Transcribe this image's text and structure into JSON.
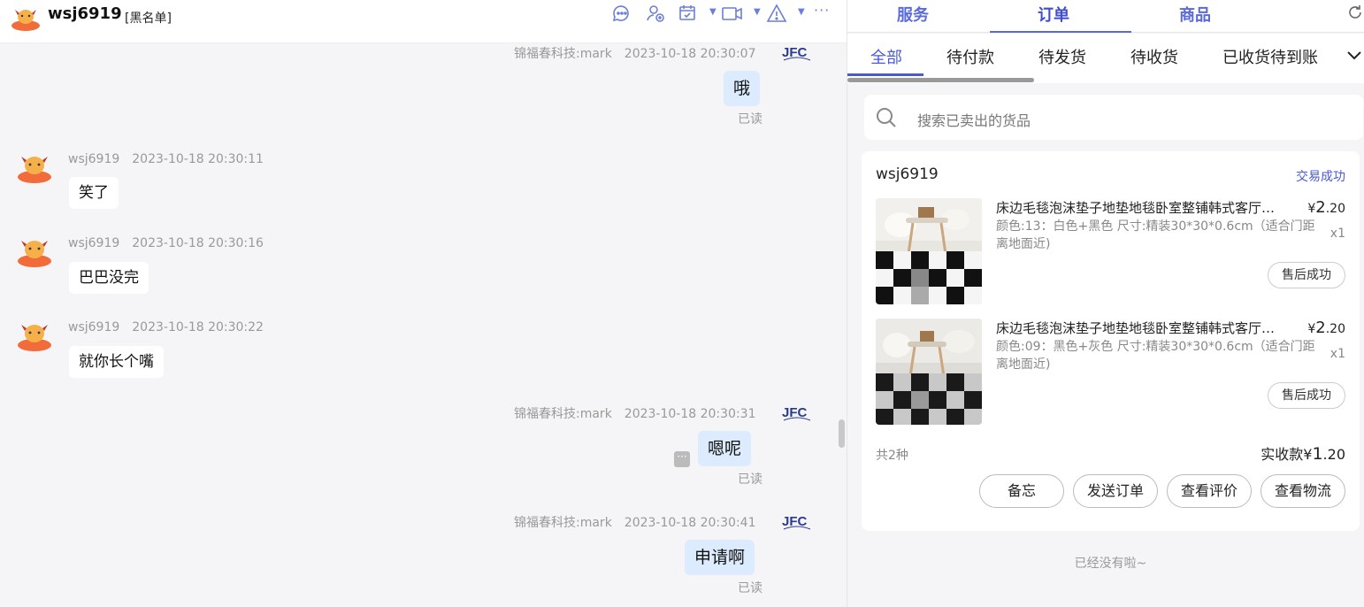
{
  "header": {
    "contact_name": "wsj6919",
    "contact_tag": "[黑名单]"
  },
  "messages": [
    {
      "sender": "锦福春科技:mark",
      "time": "2023-10-18 20:30:07",
      "text": "哦",
      "status": "已读",
      "mine": true
    },
    {
      "sender": "wsj6919",
      "time": "2023-10-18 20:30:11",
      "text": "笑了",
      "mine": false
    },
    {
      "sender": "wsj6919",
      "time": "2023-10-18 20:30:16",
      "text": "巴巴没完",
      "mine": false
    },
    {
      "sender": "wsj6919",
      "time": "2023-10-18 20:30:22",
      "text": "就你长个嘴",
      "mine": false
    },
    {
      "sender": "锦福春科技:mark",
      "time": "2023-10-18 20:30:31",
      "text": "嗯呢",
      "status": "已读",
      "mine": true
    },
    {
      "sender": "锦福春科技:mark",
      "time": "2023-10-18 20:30:41",
      "text": "申请啊",
      "status": "已读",
      "mine": true
    }
  ],
  "side": {
    "top_tabs": [
      "服务",
      "订单",
      "商品"
    ],
    "active_top_tab": "订单",
    "sub_tabs": [
      "全部",
      "待付款",
      "待发货",
      "待收货",
      "已收货待到账"
    ],
    "active_sub_tab": "全部",
    "search_placeholder": "搜索已卖出的货品",
    "order": {
      "buyer": "wsj6919",
      "status": "交易成功",
      "items": [
        {
          "title": "床边毛毯泡沫垫子地垫地毯卧室整铺韩式客厅…",
          "spec": "颜色:13：白色+黑色 尺寸:精装30*30*0.6cm（适合门距离地面近)",
          "currency": "¥",
          "price": "2",
          "price_decimal": ".20",
          "qty": "x1",
          "after_sale": "售后成功"
        },
        {
          "title": "床边毛毯泡沫垫子地垫地毯卧室整铺韩式客厅…",
          "spec": "颜色:09：黑色+灰色 尺寸:精装30*30*0.6cm（适合门距离地面近)",
          "currency": "¥",
          "price": "2",
          "price_decimal": ".20",
          "qty": "x1",
          "after_sale": "售后成功"
        }
      ],
      "count_text": "共2种",
      "total_label": "实收款",
      "total_currency": "¥",
      "total_int": "1",
      "total_decimal": ".20",
      "actions": [
        "备忘",
        "发送订单",
        "查看评价",
        "查看物流"
      ]
    },
    "no_more": "已经没有啦~"
  },
  "icons": {
    "accent": "#6b7fd7",
    "brand_blue": "#4a5ad2",
    "bubble_mine": "#dcebfd"
  }
}
